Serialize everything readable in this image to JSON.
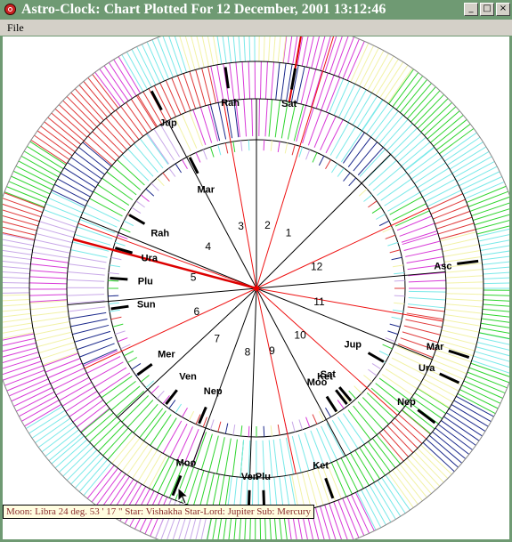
{
  "window": {
    "title": "Astro-Clock: Chart Plotted For 12 December, 2001 13:12:46",
    "buttons": [
      "_",
      "□",
      "×"
    ]
  },
  "menu": {
    "file": "File"
  },
  "colors": {
    "lines": [
      "#2fd52f",
      "#d83ad8",
      "#c8a8e8",
      "#79e9e9",
      "#f2f2a6",
      "#1c2a8c",
      "#e03a3a",
      "#9a9a9a",
      "#1a1a1a"
    ],
    "accent": "#ee1111",
    "tooltip_text": "#8a2a2a"
  },
  "houses": [
    {
      "label": "1",
      "theta": 60
    },
    {
      "label": "2",
      "theta": 80
    },
    {
      "label": "3",
      "theta": 104
    },
    {
      "label": "4",
      "theta": 139
    },
    {
      "label": "5",
      "theta": 170
    },
    {
      "label": "6",
      "theta": 201
    },
    {
      "label": "7",
      "theta": 232
    },
    {
      "label": "8",
      "theta": 262
    },
    {
      "label": "9",
      "theta": 284
    },
    {
      "label": "10",
      "theta": 313
    },
    {
      "label": "11",
      "theta": 348
    },
    {
      "label": "12",
      "theta": 20
    }
  ],
  "cusps": [
    45,
    73,
    90,
    118,
    158,
    185,
    223,
    250,
    268,
    298,
    338,
    5
  ],
  "red_cusps": [
    73,
    267
  ],
  "natal_planets": [
    {
      "label": "Mar",
      "theta": 117
    },
    {
      "label": "Rah",
      "theta": 150
    },
    {
      "label": "Ura",
      "theta": 164
    },
    {
      "label": "Plu",
      "theta": 176
    },
    {
      "label": "Sun",
      "theta": 188
    },
    {
      "label": "Mer",
      "theta": 216
    },
    {
      "label": "Nep",
      "theta": 247
    },
    {
      "label": "Ven",
      "theta": 232
    },
    {
      "label": "Jup",
      "theta": 330
    },
    {
      "label": "Ket",
      "theta": 308
    },
    {
      "label": "Sat",
      "theta": 310
    },
    {
      "label": "Moo",
      "theta": 303
    }
  ],
  "transit_planets": [
    {
      "label": "Jup",
      "theta": 118
    },
    {
      "label": "Rah",
      "theta": 98
    },
    {
      "label": "Sat",
      "theta": 80
    },
    {
      "label": "Asc",
      "theta": 7
    },
    {
      "label": "Mar",
      "theta": 342
    },
    {
      "label": "Ura",
      "theta": 335
    },
    {
      "label": "Nep",
      "theta": 323
    },
    {
      "label": "Ket",
      "theta": 290
    },
    {
      "label": "Plu",
      "theta": 272
    },
    {
      "label": "Ven",
      "theta": 268
    },
    {
      "label": "Moo",
      "theta": 248
    }
  ],
  "tooltip": "Moon: Libra 24 deg. 53 ' 17 \" Star: Vishakha Star-Lord: Jupiter Sub: Mercury"
}
